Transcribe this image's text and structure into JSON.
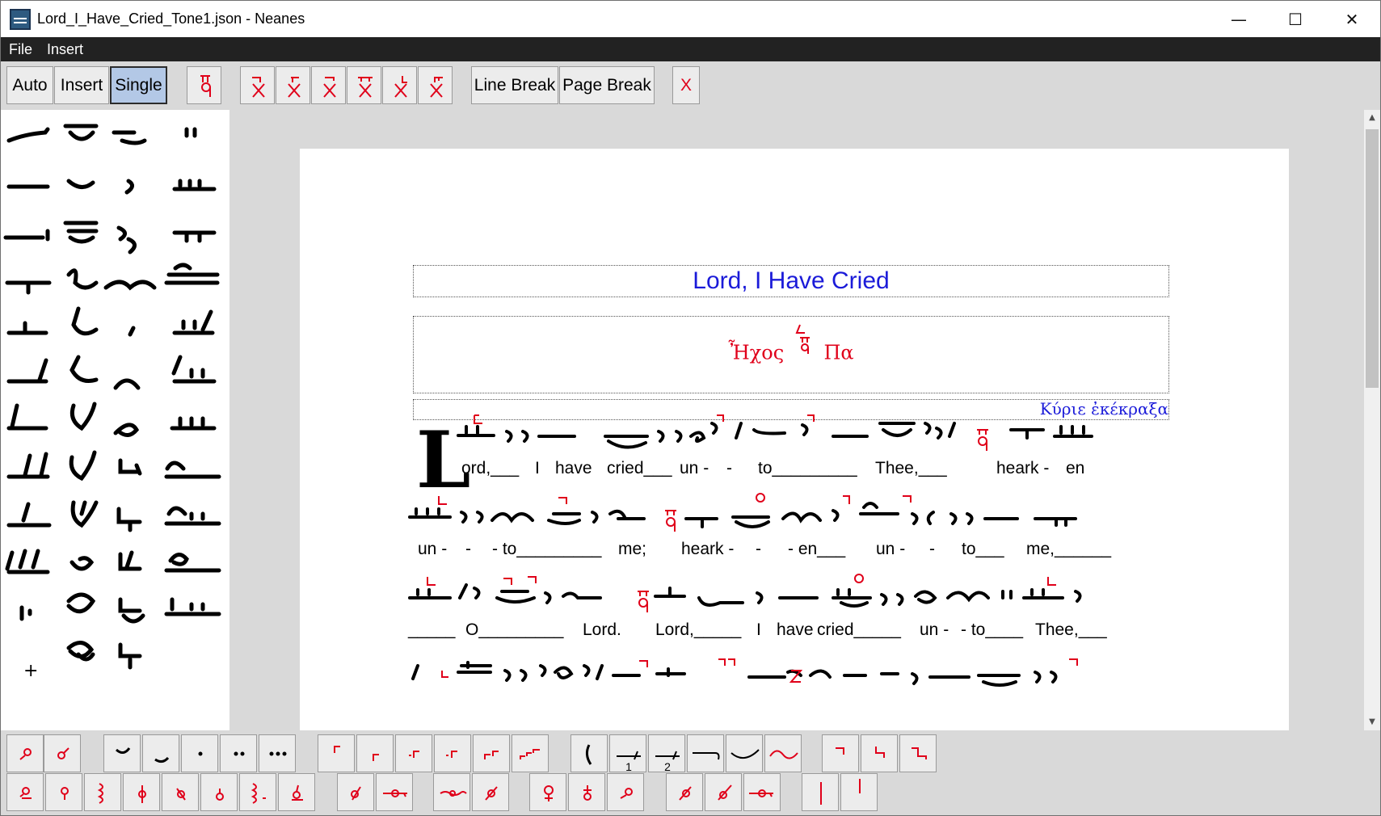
{
  "window": {
    "title": "Lord_I_Have_Cried_Tone1.json - Neanes",
    "controls": {
      "minimize": "—",
      "maximize": "☐",
      "close": "✕"
    }
  },
  "menu": {
    "items": [
      "File",
      "Insert"
    ]
  },
  "toolbar": {
    "mode_buttons": [
      "Auto",
      "Insert",
      "Single"
    ],
    "active_mode": "Single",
    "line_break": "Line Break",
    "page_break": "Page Break",
    "delete": "X"
  },
  "document": {
    "title": "Lord, I Have Cried",
    "mode_key": {
      "prefix": "Ἦχος",
      "name": "Πα"
    },
    "incipit": "Κύριε ἐκέκραξα",
    "drop_cap": "L",
    "lines": [
      [
        "ord,___",
        "I",
        "have",
        "cried___",
        "un -",
        "-",
        "to_________",
        "Thee,___",
        "heark -",
        "en"
      ],
      [
        "un -",
        "-",
        "- to_________",
        "me;",
        "heark -",
        "-",
        "- en___",
        "un -",
        "-",
        "to___",
        "me,______"
      ],
      [
        "_____",
        "O_________",
        "Lord.",
        "Lord,_____",
        "I",
        "have",
        "cried_____",
        "un -",
        "- to____",
        "Thee,___"
      ]
    ]
  },
  "palette": {
    "plus_label": "+"
  },
  "colors": {
    "accent_red": "#e0001a",
    "title_blue": "#1b1bd9",
    "active_button": "#b3c8e6",
    "menubar": "#222222"
  }
}
